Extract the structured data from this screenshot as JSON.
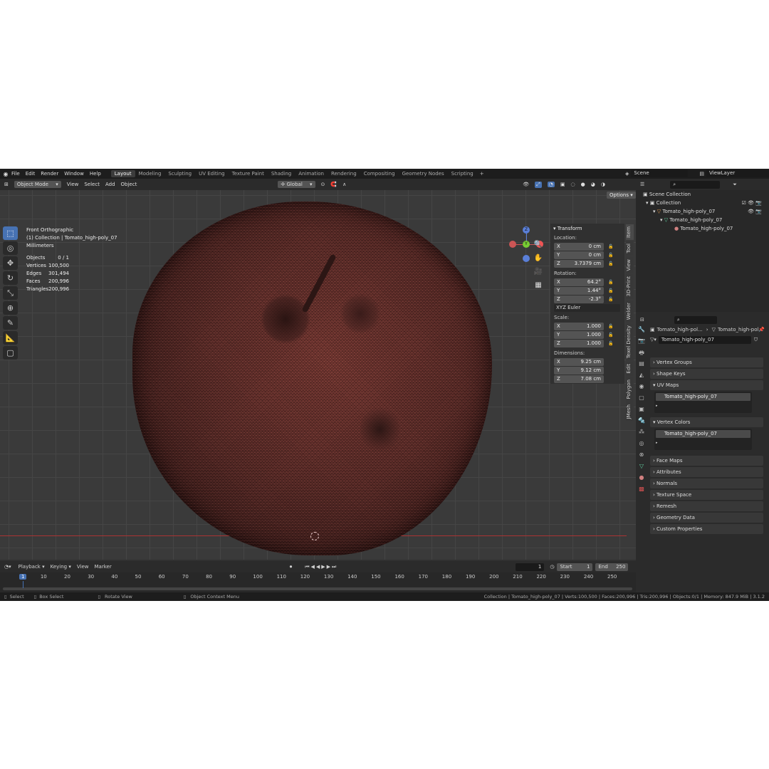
{
  "menu": [
    "File",
    "Edit",
    "Render",
    "Window",
    "Help"
  ],
  "workspaces": [
    "Layout",
    "Modeling",
    "Sculpting",
    "UV Editing",
    "Texture Paint",
    "Shading",
    "Animation",
    "Rendering",
    "Compositing",
    "Geometry Nodes",
    "Scripting"
  ],
  "add_workspace": "+",
  "scene": "Scene",
  "view_layer": "ViewLayer",
  "viewport_header": {
    "mode": "Object Mode",
    "menus": [
      "View",
      "Select",
      "Add",
      "Object"
    ],
    "orientation": "Global",
    "options": "Options"
  },
  "overlay": {
    "view_name": "Front Orthographic",
    "collection": "(1) Collection | Tomato_high-poly_07",
    "units": "Millimeters"
  },
  "stats": [
    {
      "label": "Objects",
      "value": "0 / 1"
    },
    {
      "label": "Vertices",
      "value": "100,500"
    },
    {
      "label": "Edges",
      "value": "301,494"
    },
    {
      "label": "Faces",
      "value": "200,996"
    },
    {
      "label": "Triangles",
      "value": "200,996"
    }
  ],
  "gizmo": {
    "z": "Z",
    "y": "Y"
  },
  "transform": {
    "title": "Transform",
    "location_label": "Location:",
    "location": [
      {
        "axis": "X",
        "value": "0 cm"
      },
      {
        "axis": "Y",
        "value": "0 cm"
      },
      {
        "axis": "Z",
        "value": "3.7379 cm"
      }
    ],
    "rotation_label": "Rotation:",
    "rotation": [
      {
        "axis": "X",
        "value": "64.2°"
      },
      {
        "axis": "Y",
        "value": "1.44°"
      },
      {
        "axis": "Z",
        "value": "-2.3°"
      }
    ],
    "rotation_mode": "XYZ Euler",
    "scale_label": "Scale:",
    "scale": [
      {
        "axis": "X",
        "value": "1.000"
      },
      {
        "axis": "Y",
        "value": "1.000"
      },
      {
        "axis": "Z",
        "value": "1.000"
      }
    ],
    "dimensions_label": "Dimensions:",
    "dimensions": [
      {
        "axis": "X",
        "value": "9.25 cm"
      },
      {
        "axis": "Y",
        "value": "9.12 cm"
      },
      {
        "axis": "Z",
        "value": "7.08 cm"
      }
    ]
  },
  "side_tabs": [
    "Item",
    "Tool",
    "View",
    "3D-Print",
    "Welder",
    "Texel Density",
    "Edit",
    "Polygon",
    "JMesh"
  ],
  "outliner": {
    "scene_collection": "Scene Collection",
    "collection": "Collection",
    "object": "Tomato_high-poly_07",
    "mesh": "Tomato_high-poly_07",
    "material": "Tomato_high-poly_07"
  },
  "properties": {
    "breadcrumb_object": "Tomato_high-pol...",
    "breadcrumb_mesh": "Tomato_high-pol...",
    "mesh_name": "Tomato_high-poly_07",
    "sections": [
      "Vertex Groups",
      "Shape Keys",
      "UV Maps",
      "Vertex Colors",
      "Face Maps",
      "Attributes",
      "Normals",
      "Texture Space",
      "Remesh",
      "Geometry Data",
      "Custom Properties"
    ],
    "uv_map": "Tomato_high-poly_07",
    "vertex_color": "Tomato_high-poly_07"
  },
  "timeline": {
    "menus": [
      "Playback",
      "Keying",
      "View",
      "Marker"
    ],
    "current_frame": "1",
    "start_label": "Start",
    "start": "1",
    "end_label": "End",
    "end": "250",
    "ticks": [
      "1",
      "10",
      "20",
      "30",
      "40",
      "50",
      "60",
      "70",
      "80",
      "90",
      "100",
      "110",
      "120",
      "130",
      "140",
      "150",
      "160",
      "170",
      "180",
      "190",
      "200",
      "210",
      "220",
      "230",
      "240",
      "250"
    ]
  },
  "statusbar": {
    "select": "Select",
    "box_select": "Box Select",
    "rotate_view": "Rotate View",
    "context_menu": "Object Context Menu",
    "info": "Collection | Tomato_high-poly_07 | Verts:100,500 | Faces:200,996 | Tris:200,996 | Objects:0/1 | Memory: 847.9 MiB | 3.1.2"
  }
}
